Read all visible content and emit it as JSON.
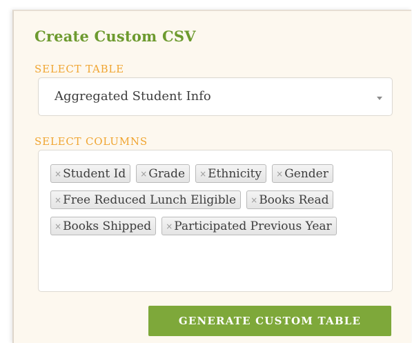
{
  "panel": {
    "title": "Create Custom CSV"
  },
  "select_table": {
    "label": "SELECT TABLE",
    "value": "Aggregated Student Info"
  },
  "select_columns": {
    "label": "SELECT COLUMNS",
    "remove_glyph": "×",
    "tags": [
      {
        "label": "Student Id"
      },
      {
        "label": "Grade"
      },
      {
        "label": "Ethnicity"
      },
      {
        "label": "Gender"
      },
      {
        "label": "Free Reduced Lunch Eligible"
      },
      {
        "label": "Books Read"
      },
      {
        "label": "Books Shipped"
      },
      {
        "label": "Participated Previous Year"
      }
    ]
  },
  "actions": {
    "generate_label": "GENERATE CUSTOM TABLE"
  },
  "colors": {
    "title_green": "#6d9a2f",
    "label_orange": "#f0a531",
    "button_green": "#7ea83a",
    "panel_background": "#fdf8ef"
  },
  "icons": {
    "dropdown": "chevron-down-icon",
    "tag_remove": "close-icon"
  }
}
